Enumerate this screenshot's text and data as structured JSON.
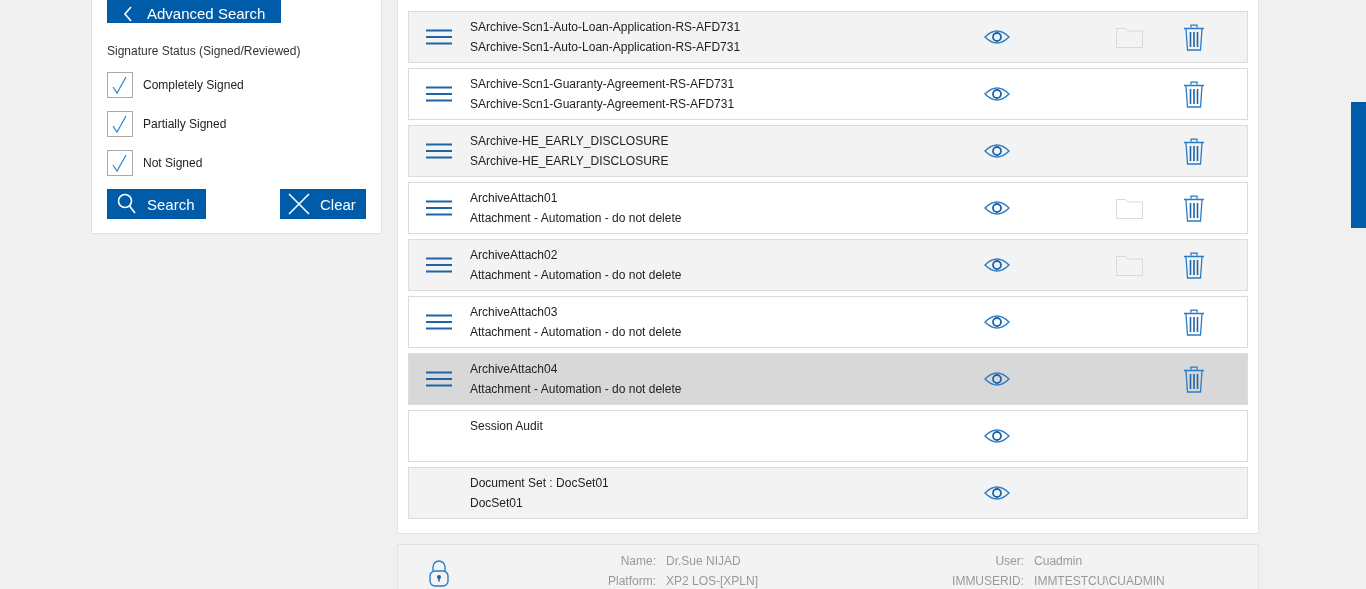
{
  "filter_panel": {
    "advanced_search_button": "Advanced Search",
    "signature_status_label": "Signature Status (Signed/Reviewed)",
    "checkboxes": [
      {
        "label": "Completely Signed",
        "checked": true
      },
      {
        "label": "Partially Signed",
        "checked": true
      },
      {
        "label": "Not Signed",
        "checked": true
      }
    ],
    "search_button": "Search",
    "clear_button": "Clear"
  },
  "documents": [
    {
      "title": "SArchive-Scn1-Auto-Loan-Application-RS-AFD731",
      "subtitle": "SArchive-Scn1-Auto-Loan-Application-RS-AFD731",
      "handle": true,
      "folder": true,
      "trash": true,
      "selected": false
    },
    {
      "title": "SArchive-Scn1-Guaranty-Agreement-RS-AFD731",
      "subtitle": "SArchive-Scn1-Guaranty-Agreement-RS-AFD731",
      "handle": true,
      "folder": false,
      "trash": true,
      "selected": false
    },
    {
      "title": "SArchive-HE_EARLY_DISCLOSURE",
      "subtitle": "SArchive-HE_EARLY_DISCLOSURE",
      "handle": true,
      "folder": false,
      "trash": true,
      "selected": false
    },
    {
      "title": "ArchiveAttach01",
      "subtitle": "Attachment - Automation - do not delete",
      "handle": true,
      "folder": true,
      "trash": true,
      "selected": false
    },
    {
      "title": "ArchiveAttach02",
      "subtitle": "Attachment - Automation - do not delete",
      "handle": true,
      "folder": true,
      "trash": true,
      "selected": false
    },
    {
      "title": "ArchiveAttach03",
      "subtitle": "Attachment - Automation - do not delete",
      "handle": true,
      "folder": false,
      "trash": true,
      "selected": false
    },
    {
      "title": "ArchiveAttach04",
      "subtitle": "Attachment - Automation - do not delete",
      "handle": true,
      "folder": false,
      "trash": true,
      "selected": true
    },
    {
      "title": "Session Audit",
      "handle": false,
      "folder": false,
      "trash": false,
      "selected": false
    },
    {
      "title": "Document Set : DocSet01",
      "subtitle": "DocSet01",
      "handle": false,
      "folder": false,
      "trash": false,
      "selected": false
    }
  ],
  "footer": {
    "left": [
      {
        "label": "Name:",
        "value": "Dr.Sue NIJAD"
      },
      {
        "label": "Platform:",
        "value": "XP2 LOS-[XPLN]"
      }
    ],
    "right": [
      {
        "label": "User:",
        "value": "Cuadmin"
      },
      {
        "label": "IMMUSERID:",
        "value": "IMMTESTCU\\CUADMIN"
      }
    ]
  }
}
